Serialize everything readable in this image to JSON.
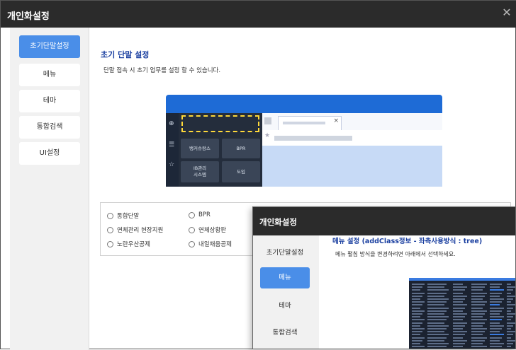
{
  "window": {
    "title": "개인화설정",
    "close_icon": "close-icon"
  },
  "sidebar": {
    "items": [
      {
        "label": "초기단말설정",
        "active": true
      },
      {
        "label": "메뉴",
        "active": false
      },
      {
        "label": "테마",
        "active": false
      },
      {
        "label": "통합검색",
        "active": false
      },
      {
        "label": "UI설정",
        "active": false
      }
    ]
  },
  "section": {
    "title": "초기 단말 설정",
    "description": "단말 접속 시 초기 업무를 설정 할 수 있습니다."
  },
  "preview": {
    "menu_buttons": [
      "뱅커슈랑스",
      "BPR",
      "IB관리\n시스템",
      "도입"
    ],
    "tab_close": "×",
    "star": "★",
    "accent": "#1e6bd6",
    "dash_color": "#ffd93a"
  },
  "radios": [
    {
      "label": "통합단말"
    },
    {
      "label": "BPR"
    },
    {
      "label": "연체관리 현장지원"
    },
    {
      "label": "연체상황판"
    },
    {
      "label": "노란우산공제"
    },
    {
      "label": "내일채움공제"
    }
  ],
  "overlay": {
    "title": "개인화설정",
    "sidebar": [
      {
        "label": "초기단말설정",
        "active": false
      },
      {
        "label": "메뉴",
        "active": true
      },
      {
        "label": "테마",
        "active": false
      },
      {
        "label": "통합검색",
        "active": false
      }
    ],
    "section_title": "메뉴 설정 (addClass정보 - 좌측사용방식 : tree)",
    "section_desc": "메뉴 펼침 방식을 변경하려면 아래에서 선택하세요."
  },
  "colors": {
    "active_tab": "#4a8ee8",
    "title_bar": "#2b2b2b",
    "section_title": "#1a3fa0"
  }
}
